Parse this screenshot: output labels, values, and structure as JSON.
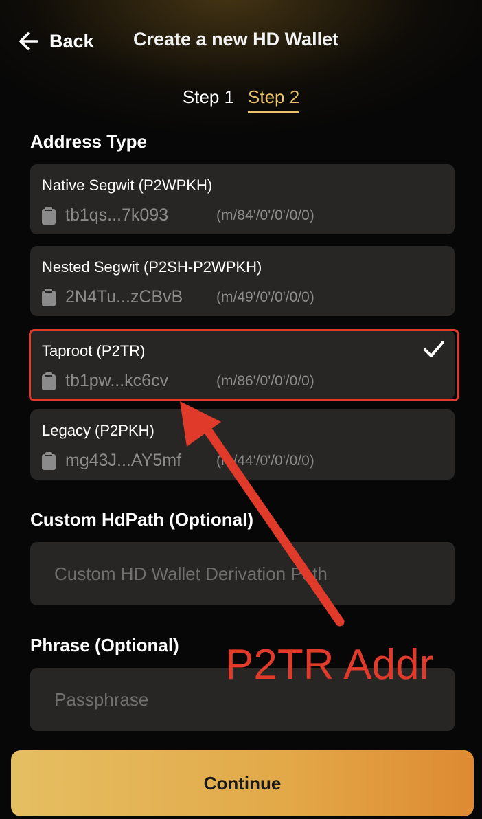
{
  "header": {
    "back_label": "Back",
    "title": "Create a new HD Wallet"
  },
  "steps": [
    {
      "label": "Step 1",
      "active": false
    },
    {
      "label": "Step 2",
      "active": true
    }
  ],
  "address_type": {
    "heading": "Address Type",
    "options": [
      {
        "name": "Native Segwit (P2WPKH)",
        "address": "tb1qs...7k093",
        "path": "(m/84'/0'/0'/0/0)",
        "selected": false
      },
      {
        "name": "Nested Segwit (P2SH-P2WPKH)",
        "address": "2N4Tu...zCBvB",
        "path": "(m/49'/0'/0'/0/0)",
        "selected": false
      },
      {
        "name": "Taproot (P2TR)",
        "address": "tb1pw...kc6cv",
        "path": "(m/86'/0'/0'/0/0)",
        "selected": true
      },
      {
        "name": "Legacy (P2PKH)",
        "address": "mg43J...AY5mf",
        "path": "(m/44'/0'/0'/0/0)",
        "selected": false
      }
    ]
  },
  "custom_hdpath": {
    "heading": "Custom HdPath (Optional)",
    "placeholder": "Custom HD Wallet Derivation Path",
    "value": ""
  },
  "phrase": {
    "heading": "Phrase (Optional)",
    "placeholder": "Passphrase",
    "value": ""
  },
  "annotation": {
    "text": "P2TR Addr",
    "color": "#e03a2a"
  },
  "continue_label": "Continue",
  "colors": {
    "accent": "#e9c46a",
    "button_start": "#e4bf62",
    "button_end": "#de8a32",
    "card_bg": "#272625"
  }
}
